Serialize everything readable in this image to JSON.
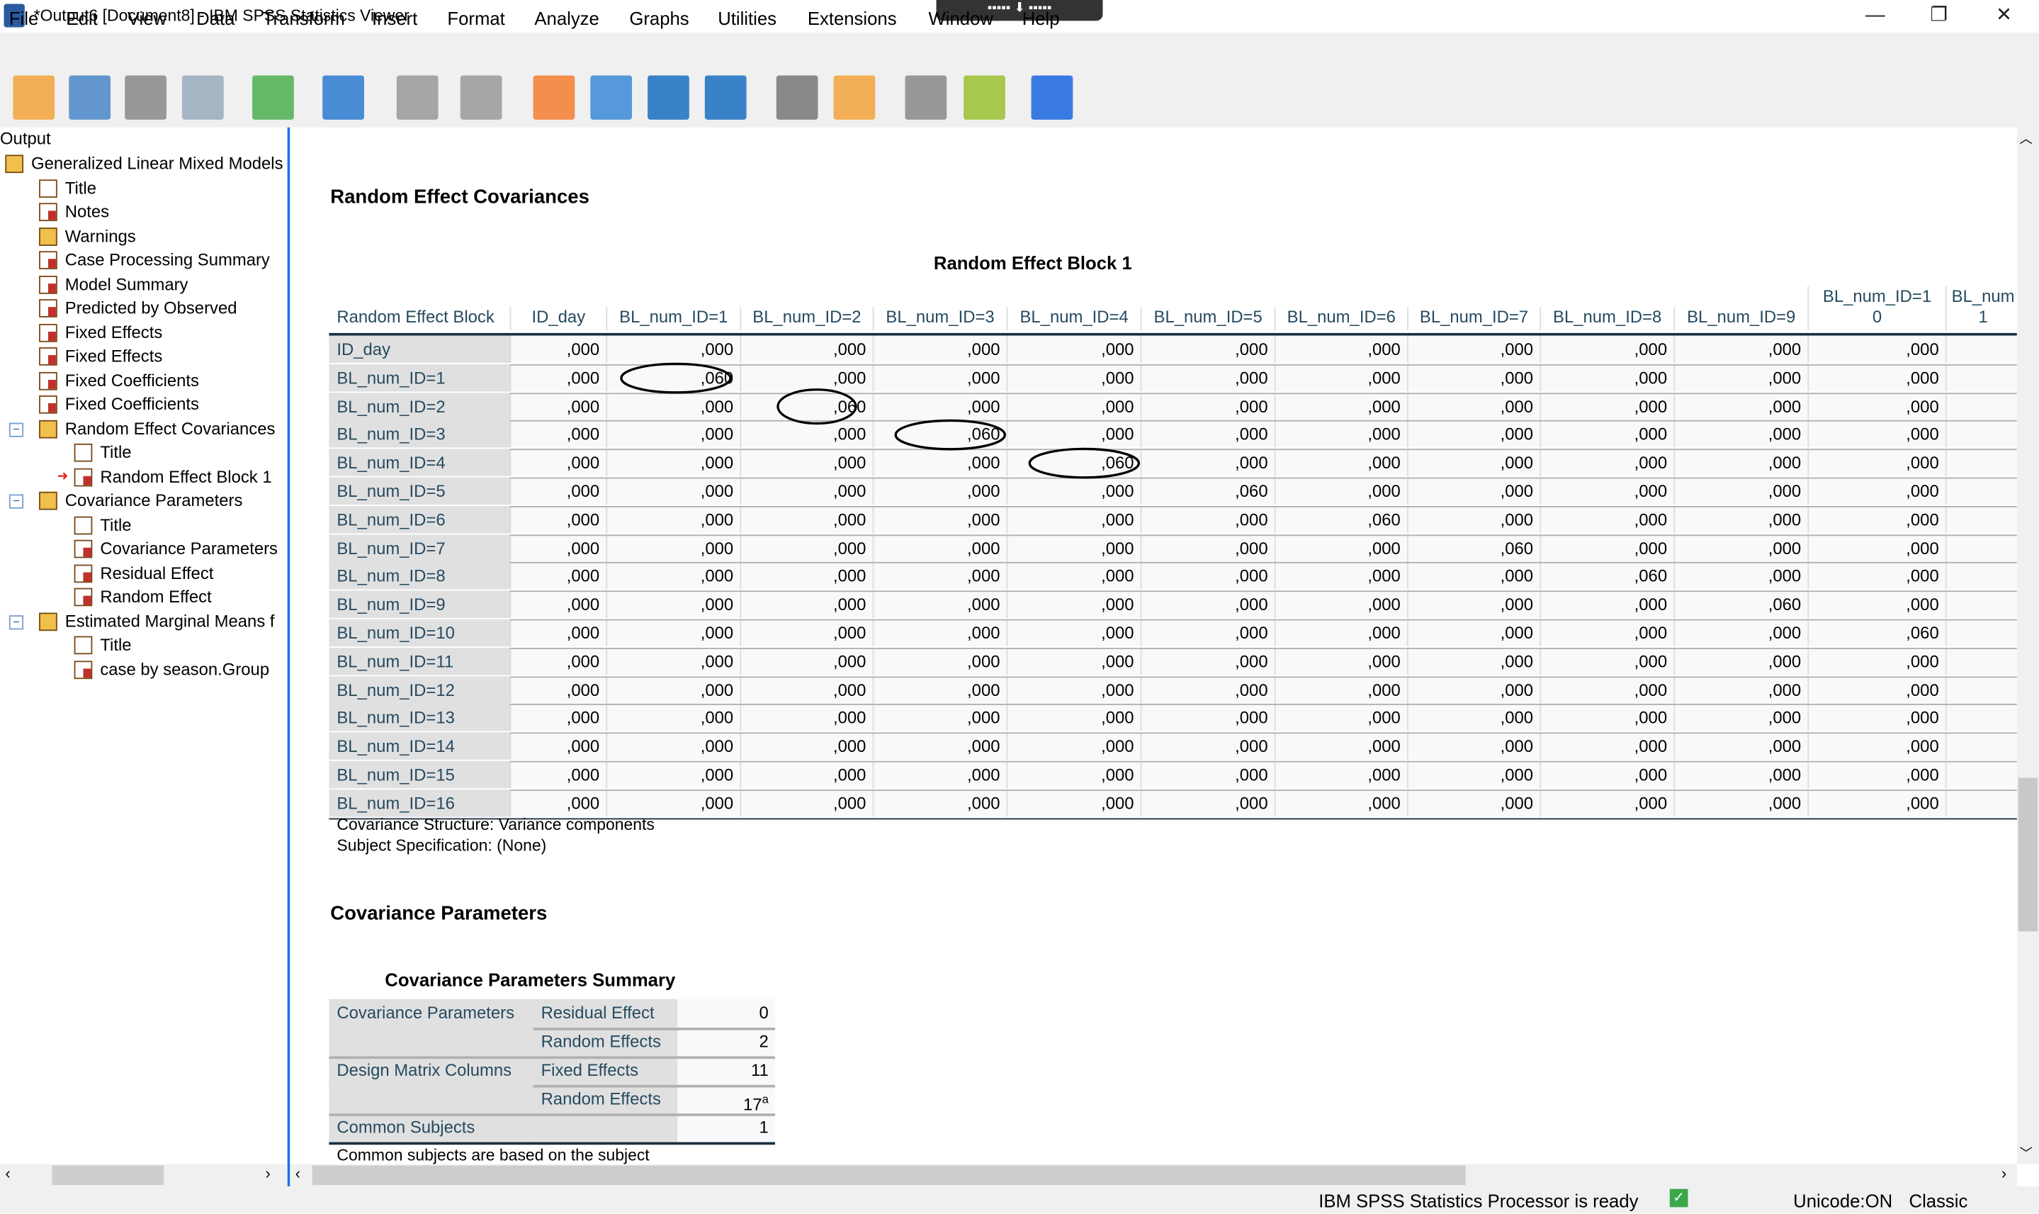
{
  "window": {
    "title": "*Output6 [Document8] - IBM SPSS Statistics Viewer",
    "minimize": "—",
    "restore": "❐",
    "close": "✕"
  },
  "menu": [
    "File",
    "Edit",
    "View",
    "Data",
    "Transform",
    "Insert",
    "Format",
    "Analyze",
    "Graphs",
    "Utilities",
    "Extensions",
    "Window",
    "Help"
  ],
  "toolbar": [
    {
      "icon": "open-folder-icon",
      "color": "#f2a33a"
    },
    {
      "icon": "save-icon",
      "color": "#4a86c8"
    },
    {
      "icon": "print-icon",
      "color": "#888888"
    },
    {
      "icon": "print-preview-icon",
      "color": "#9ab"
    },
    {
      "icon": "export-icon",
      "color": "#4caf50"
    },
    {
      "icon": "recall-dialog-icon",
      "color": "#2a7ad0"
    },
    {
      "icon": "undo-icon",
      "color": "#999999"
    },
    {
      "icon": "redo-icon",
      "color": "#999999"
    },
    {
      "icon": "goto-data-icon",
      "color": "#f47c30"
    },
    {
      "icon": "goto-case-icon",
      "color": "#3a8ad8"
    },
    {
      "icon": "insert-output-icon",
      "color": "#1a6ec0"
    },
    {
      "icon": "variables-icon",
      "color": "#1a6ec0"
    },
    {
      "icon": "insert-text-icon",
      "color": "#777"
    },
    {
      "icon": "run-script-icon",
      "color": "#f2a33a"
    },
    {
      "icon": "hide-icon",
      "color": "#888"
    },
    {
      "icon": "designate-window-icon",
      "color": "#9ac030"
    },
    {
      "icon": "search-icon",
      "color": "#1a66e0"
    }
  ],
  "tree": {
    "root": "Output",
    "items": [
      {
        "label": "Generalized Linear Mixed Models",
        "level": 0,
        "type": "book",
        "toggle": "-"
      },
      {
        "label": "Title",
        "level": 1,
        "type": "page"
      },
      {
        "label": "Notes",
        "level": 1,
        "type": "table"
      },
      {
        "label": "Warnings",
        "level": 1,
        "type": "book"
      },
      {
        "label": "Case Processing Summary",
        "level": 1,
        "type": "table"
      },
      {
        "label": "Model Summary",
        "level": 1,
        "type": "table"
      },
      {
        "label": "Predicted by Observed",
        "level": 1,
        "type": "table"
      },
      {
        "label": "Fixed Effects",
        "level": 1,
        "type": "table"
      },
      {
        "label": "Fixed Effects",
        "level": 1,
        "type": "table"
      },
      {
        "label": "Fixed Coefficients",
        "level": 1,
        "type": "table"
      },
      {
        "label": "Fixed Coefficients",
        "level": 1,
        "type": "table"
      },
      {
        "label": "Random Effect Covariances",
        "level": 1,
        "type": "book",
        "toggle": "-"
      },
      {
        "label": "Title",
        "level": 2,
        "type": "page"
      },
      {
        "label": "Random Effect Block 1",
        "level": 2,
        "type": "table",
        "current": true
      },
      {
        "label": "Covariance Parameters",
        "level": 1,
        "type": "book",
        "toggle": "-"
      },
      {
        "label": "Title",
        "level": 2,
        "type": "page"
      },
      {
        "label": "Covariance Parameters",
        "level": 2,
        "type": "table"
      },
      {
        "label": "Residual Effect",
        "level": 2,
        "type": "table"
      },
      {
        "label": "Random Effect",
        "level": 2,
        "type": "table"
      },
      {
        "label": "Estimated Marginal Means f",
        "level": 1,
        "type": "book",
        "toggle": "-"
      },
      {
        "label": "Title",
        "level": 2,
        "type": "page"
      },
      {
        "label": "case by season.Group",
        "level": 2,
        "type": "table"
      }
    ]
  },
  "content": {
    "section1_title": "Random Effect Covariances",
    "block": {
      "title": "Random Effect Block 1",
      "corner": "Random Effect Block",
      "columns": [
        "ID_day",
        "BL_num_ID=1",
        "BL_num_ID=2",
        "BL_num_ID=3",
        "BL_num_ID=4",
        "BL_num_ID=5",
        "BL_num_ID=6",
        "BL_num_ID=7",
        "BL_num_ID=8",
        "BL_num_ID=9",
        "BL_num_ID=1\n0",
        "BL_num\n1"
      ],
      "rows": [
        {
          "label": "ID_day",
          "values": [
            ",000",
            ",000",
            ",000",
            ",000",
            ",000",
            ",000",
            ",000",
            ",000",
            ",000",
            ",000",
            ",000",
            ""
          ]
        },
        {
          "label": "BL_num_ID=1",
          "values": [
            ",000",
            ",060",
            ",000",
            ",000",
            ",000",
            ",000",
            ",000",
            ",000",
            ",000",
            ",000",
            ",000",
            ""
          ]
        },
        {
          "label": "BL_num_ID=2",
          "values": [
            ",000",
            ",000",
            ",060",
            ",000",
            ",000",
            ",000",
            ",000",
            ",000",
            ",000",
            ",000",
            ",000",
            ""
          ]
        },
        {
          "label": "BL_num_ID=3",
          "values": [
            ",000",
            ",000",
            ",000",
            ",060",
            ",000",
            ",000",
            ",000",
            ",000",
            ",000",
            ",000",
            ",000",
            ""
          ]
        },
        {
          "label": "BL_num_ID=4",
          "values": [
            ",000",
            ",000",
            ",000",
            ",000",
            ",060",
            ",000",
            ",000",
            ",000",
            ",000",
            ",000",
            ",000",
            ""
          ]
        },
        {
          "label": "BL_num_ID=5",
          "values": [
            ",000",
            ",000",
            ",000",
            ",000",
            ",000",
            ",060",
            ",000",
            ",000",
            ",000",
            ",000",
            ",000",
            ""
          ]
        },
        {
          "label": "BL_num_ID=6",
          "values": [
            ",000",
            ",000",
            ",000",
            ",000",
            ",000",
            ",000",
            ",060",
            ",000",
            ",000",
            ",000",
            ",000",
            ""
          ]
        },
        {
          "label": "BL_num_ID=7",
          "values": [
            ",000",
            ",000",
            ",000",
            ",000",
            ",000",
            ",000",
            ",000",
            ",060",
            ",000",
            ",000",
            ",000",
            ""
          ]
        },
        {
          "label": "BL_num_ID=8",
          "values": [
            ",000",
            ",000",
            ",000",
            ",000",
            ",000",
            ",000",
            ",000",
            ",000",
            ",060",
            ",000",
            ",000",
            ""
          ]
        },
        {
          "label": "BL_num_ID=9",
          "values": [
            ",000",
            ",000",
            ",000",
            ",000",
            ",000",
            ",000",
            ",000",
            ",000",
            ",000",
            ",060",
            ",000",
            ""
          ]
        },
        {
          "label": "BL_num_ID=10",
          "values": [
            ",000",
            ",000",
            ",000",
            ",000",
            ",000",
            ",000",
            ",000",
            ",000",
            ",000",
            ",000",
            ",060",
            ""
          ]
        },
        {
          "label": "BL_num_ID=11",
          "values": [
            ",000",
            ",000",
            ",000",
            ",000",
            ",000",
            ",000",
            ",000",
            ",000",
            ",000",
            ",000",
            ",000",
            ""
          ]
        },
        {
          "label": "BL_num_ID=12",
          "values": [
            ",000",
            ",000",
            ",000",
            ",000",
            ",000",
            ",000",
            ",000",
            ",000",
            ",000",
            ",000",
            ",000",
            ""
          ]
        },
        {
          "label": "BL_num_ID=13",
          "values": [
            ",000",
            ",000",
            ",000",
            ",000",
            ",000",
            ",000",
            ",000",
            ",000",
            ",000",
            ",000",
            ",000",
            ""
          ]
        },
        {
          "label": "BL_num_ID=14",
          "values": [
            ",000",
            ",000",
            ",000",
            ",000",
            ",000",
            ",000",
            ",000",
            ",000",
            ",000",
            ",000",
            ",000",
            ""
          ]
        },
        {
          "label": "BL_num_ID=15",
          "values": [
            ",000",
            ",000",
            ",000",
            ",000",
            ",000",
            ",000",
            ",000",
            ",000",
            ",000",
            ",000",
            ",000",
            ""
          ]
        },
        {
          "label": "BL_num_ID=16",
          "values": [
            ",000",
            ",000",
            ",000",
            ",000",
            ",000",
            ",000",
            ",000",
            ",000",
            ",000",
            ",000",
            ",000",
            ""
          ]
        }
      ],
      "footnotes": [
        "Covariance Structure: Variance components",
        "Subject Specification: (None)"
      ]
    },
    "section2_title": "Covariance Parameters",
    "summary": {
      "title": "Covariance Parameters Summary",
      "rows": [
        {
          "group": "Covariance Parameters",
          "label": "Residual Effect",
          "value": "0"
        },
        {
          "group": "",
          "label": "Random Effects",
          "value": "2"
        },
        {
          "group": "Design Matrix Columns",
          "label": "Fixed Effects",
          "value": "11"
        },
        {
          "group": "",
          "label": "Random Effects",
          "value": "17",
          "sup": "a"
        },
        {
          "group": "Common Subjects",
          "label": "",
          "value": "1"
        }
      ],
      "footnote": "Common subjects are based on the subject"
    }
  },
  "status": {
    "processor": "IBM SPSS Statistics Processor is ready",
    "unicode": "Unicode:ON",
    "mode": "Classic"
  }
}
